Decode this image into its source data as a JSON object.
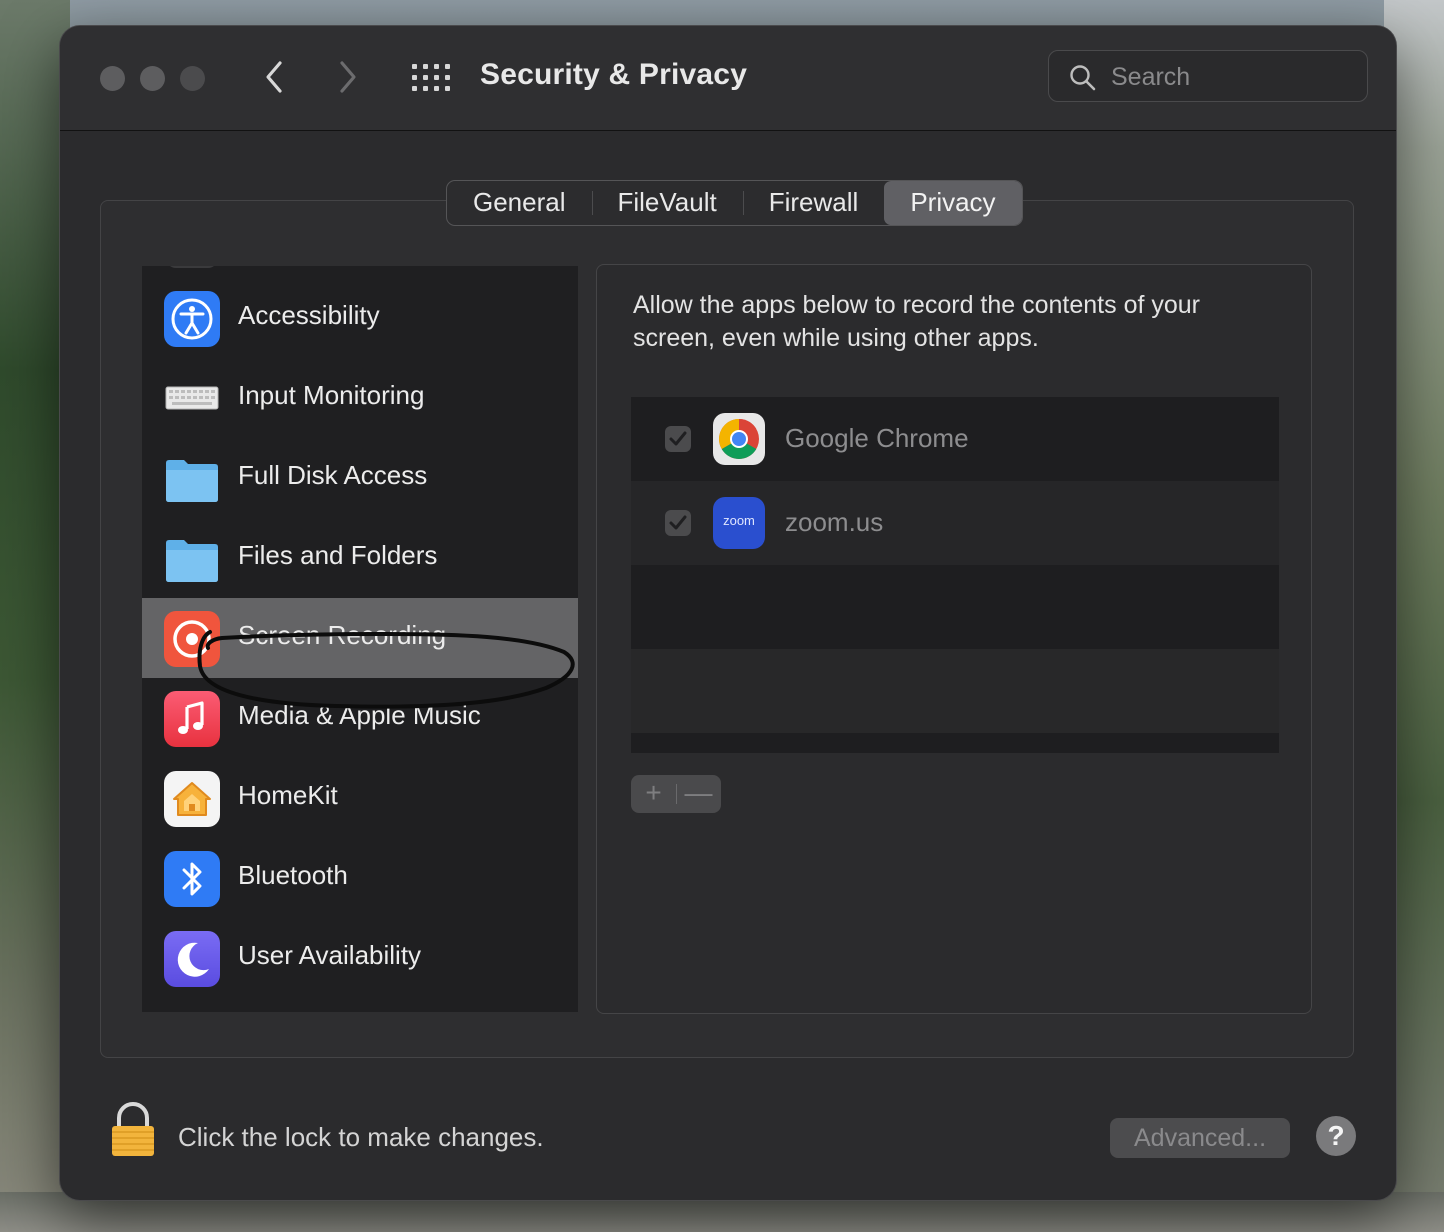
{
  "window": {
    "title": "Security & Privacy",
    "search_placeholder": "Search"
  },
  "tabs": [
    {
      "label": "General"
    },
    {
      "label": "FileVault"
    },
    {
      "label": "Firewall"
    },
    {
      "label": "Privacy",
      "selected": true
    }
  ],
  "sidebar": {
    "items": [
      {
        "label": "Accessibility",
        "icon": "accessibility-icon"
      },
      {
        "label": "Input Monitoring",
        "icon": "keyboard-icon"
      },
      {
        "label": "Full Disk Access",
        "icon": "folder-icon"
      },
      {
        "label": "Files and Folders",
        "icon": "folder-icon"
      },
      {
        "label": "Screen Recording",
        "icon": "screen-recording-icon",
        "selected": true
      },
      {
        "label": "Media & Apple Music",
        "icon": "music-icon"
      },
      {
        "label": "HomeKit",
        "icon": "home-icon"
      },
      {
        "label": "Bluetooth",
        "icon": "bluetooth-icon"
      },
      {
        "label": "User Availability",
        "icon": "moon-icon"
      }
    ]
  },
  "detail": {
    "description": "Allow the apps below to record the contents of your screen, even while using other apps.",
    "apps": [
      {
        "name": "Google Chrome",
        "checked": true,
        "icon": "chrome-icon"
      },
      {
        "name": "zoom.us",
        "checked": true,
        "icon": "zoom-icon",
        "icon_text": "zoom"
      }
    ],
    "add_label": "+",
    "remove_label": "—"
  },
  "footer": {
    "lock_text": "Click the lock to make changes.",
    "advanced_label": "Advanced...",
    "help_label": "?"
  },
  "colors": {
    "accent_blue": "#2f7bf5",
    "screen_recording_red": "#f0553d",
    "selected_row": "#646466"
  }
}
